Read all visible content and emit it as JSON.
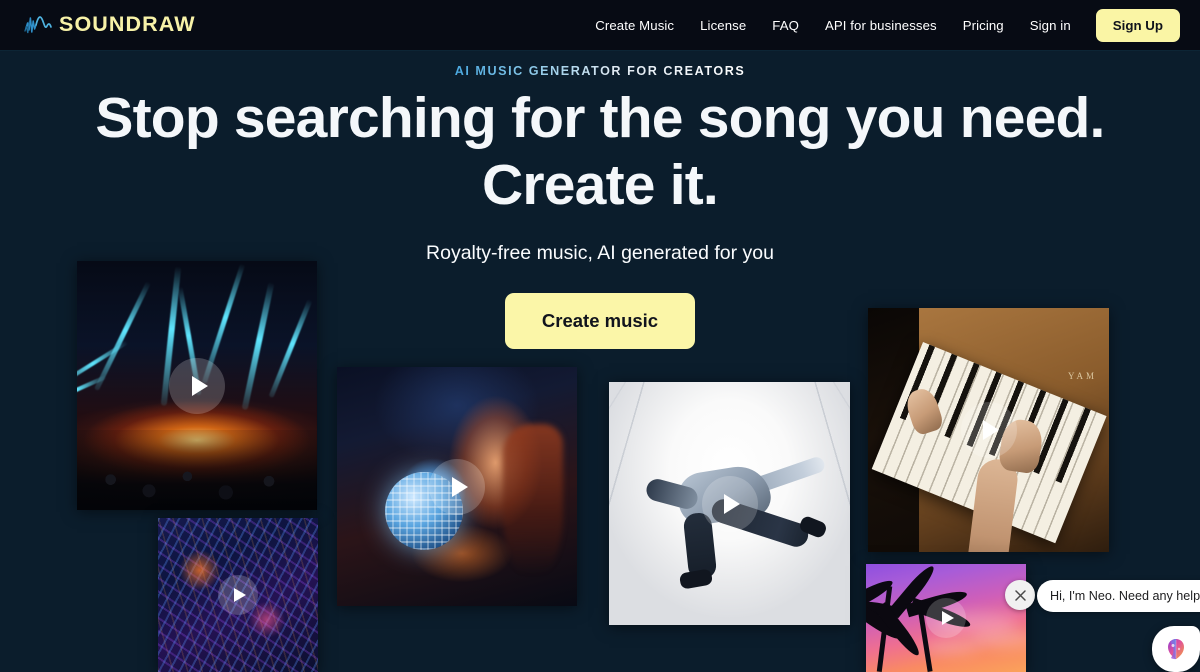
{
  "brand": {
    "name": "SOUNDRAW",
    "logo_icon": "waveform-icon",
    "logo_color": "#f7f2a8",
    "wave_color": "#3fa9d8"
  },
  "header": {
    "nav": [
      {
        "label": "Create Music",
        "name": "nav-create-music"
      },
      {
        "label": "License",
        "name": "nav-license"
      },
      {
        "label": "FAQ",
        "name": "nav-faq"
      },
      {
        "label": "API for businesses",
        "name": "nav-api-for-businesses"
      },
      {
        "label": "Pricing",
        "name": "nav-pricing"
      },
      {
        "label": "Sign in",
        "name": "nav-sign-in"
      }
    ],
    "signup_label": "Sign Up",
    "signup_bg": "#faf5a5",
    "background": "#070b14"
  },
  "hero": {
    "eyebrow": "AI MUSIC GENERATOR FOR CREATORS",
    "headline_line1": "Stop searching for the song you need.",
    "headline_line2": "Create it.",
    "subheadline": "Royalty-free music, AI generated for you",
    "cta_label": "Create music",
    "cta_bg": "#fbf6a8",
    "background": "#0b1d2c"
  },
  "gallery": {
    "play_icon": "play-icon",
    "cards": [
      {
        "name": "card-concert-lasers",
        "alt": "Concert crowd with cyan laser beams and orange stage glow"
      },
      {
        "name": "card-city-night",
        "alt": "Aerial night view of a neon-lit city"
      },
      {
        "name": "card-disco-ball",
        "alt": "Woman holding a glowing mirror disco ball"
      },
      {
        "name": "card-breakdancer",
        "alt": "Breakdancer spinning in a bright white hallway"
      },
      {
        "name": "card-piano",
        "alt": "Hands playing a wooden Yamaha upright piano"
      },
      {
        "name": "card-sunset-palms",
        "alt": "Palm trees silhouetted against a purple pink sunset"
      }
    ]
  },
  "chat": {
    "message": "Hi, I'm Neo. Need any help?",
    "close_icon": "close-icon",
    "avatar_icon": "neo-brain-icon"
  }
}
